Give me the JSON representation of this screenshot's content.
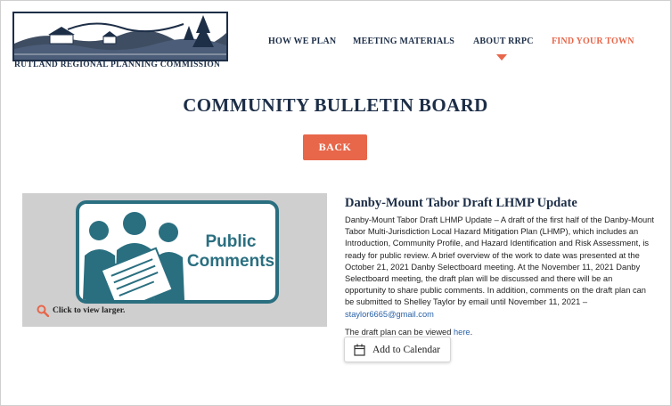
{
  "header": {
    "org_name": "RUTLAND REGIONAL PLANNING COMMISSION",
    "logo_icon": "landscape-logo",
    "nav": [
      {
        "label": "HOW WE PLAN"
      },
      {
        "label": "MEETING MATERIALS"
      },
      {
        "label": "ABOUT RRPC"
      },
      {
        "label": "FIND YOUR TOWN"
      }
    ],
    "accent_color": "#e8664a",
    "brand_color": "#1d2e47"
  },
  "page": {
    "title": "COMMUNITY BULLETIN BOARD",
    "back_label": "BACK"
  },
  "image_panel": {
    "graphic_text_line1": "Public",
    "graphic_text_line2": "Comments",
    "zoom_caption": "Click to view larger.",
    "zoom_icon": "magnifier-icon"
  },
  "article": {
    "title": "Danby-Mount Tabor Draft LHMP Update",
    "body": "Danby-Mount Tabor Draft LHMP Update – A draft of the first half of the Danby-Mount Tabor Multi-Jurisdiction Local Hazard Mitigation Plan (LHMP), which includes an Introduction, Community Profile, and Hazard Identification and Risk Assessment, is ready for public review.  A brief overview of the work to date was presented at the October 21, 2021 Danby Selectboard meeting.  At the November 11, 2021 Danby Selectboard meeting, the draft plan will be discussed and there will be an opportunity to share public comments.  In addition, comments on the draft plan can be submitted to Shelley Taylor by email until November 11, 2021 –",
    "email": "staylor6665@gmail.com",
    "draft_text": "The draft plan can be viewed",
    "draft_link": "here",
    "draft_end": ".",
    "calendar_label": "Add to Calendar",
    "calendar_icon": "calendar-icon"
  }
}
